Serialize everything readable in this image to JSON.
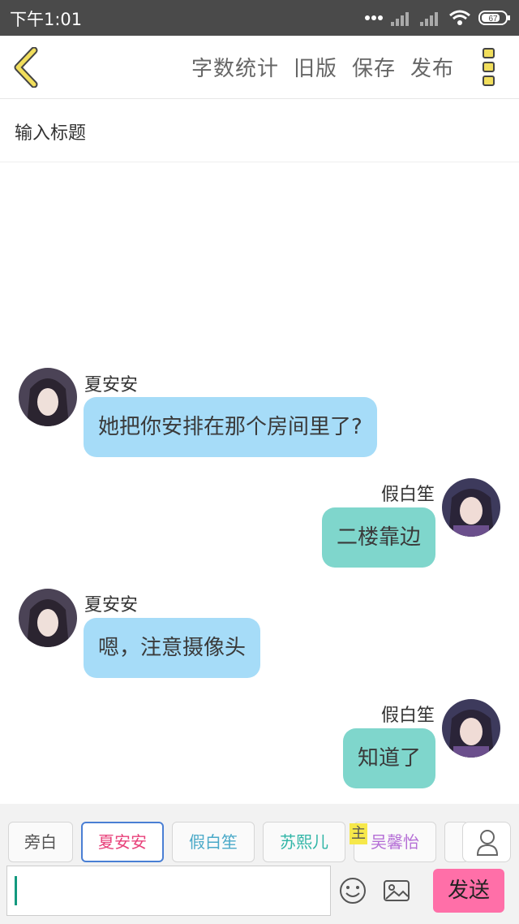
{
  "status_bar": {
    "time": "下午1:01",
    "battery": "67"
  },
  "toolbar": {
    "back_icon": "chevron-left-icon",
    "actions": [
      "字数统计",
      "旧版",
      "保存",
      "发布"
    ],
    "more_icon": "more-vertical-icon",
    "accent_color": "#f1de5c"
  },
  "title_field": {
    "placeholder": "输入标题"
  },
  "messages": [
    {
      "side": "left",
      "sender": "夏安安",
      "text": "她把你安排在那个房间里了?"
    },
    {
      "side": "right",
      "sender": "假白笙",
      "text": "二楼靠边"
    },
    {
      "side": "left",
      "sender": "夏安安",
      "text": "嗯，注意摄像头"
    },
    {
      "side": "right",
      "sender": "假白笙",
      "text": "知道了"
    }
  ],
  "characters": {
    "items": [
      {
        "name": "旁白",
        "color": "#555555"
      },
      {
        "name": "夏安安",
        "color": "#e8417a",
        "selected": true
      },
      {
        "name": "假白笙",
        "color": "#4aa9c8"
      },
      {
        "name": "苏熙儿",
        "color": "#2fb5a6"
      },
      {
        "name": "吴馨怡",
        "color": "#b56fd6",
        "badge": "主"
      }
    ],
    "person_icon": "person-icon"
  },
  "composer": {
    "emoji_icon": "smiley-icon",
    "image_icon": "image-icon",
    "send_label": "发送",
    "send_color": "#ff6fa8"
  },
  "colors": {
    "left_bubble": "#a6dcf8",
    "right_bubble": "#7fd6cc"
  }
}
